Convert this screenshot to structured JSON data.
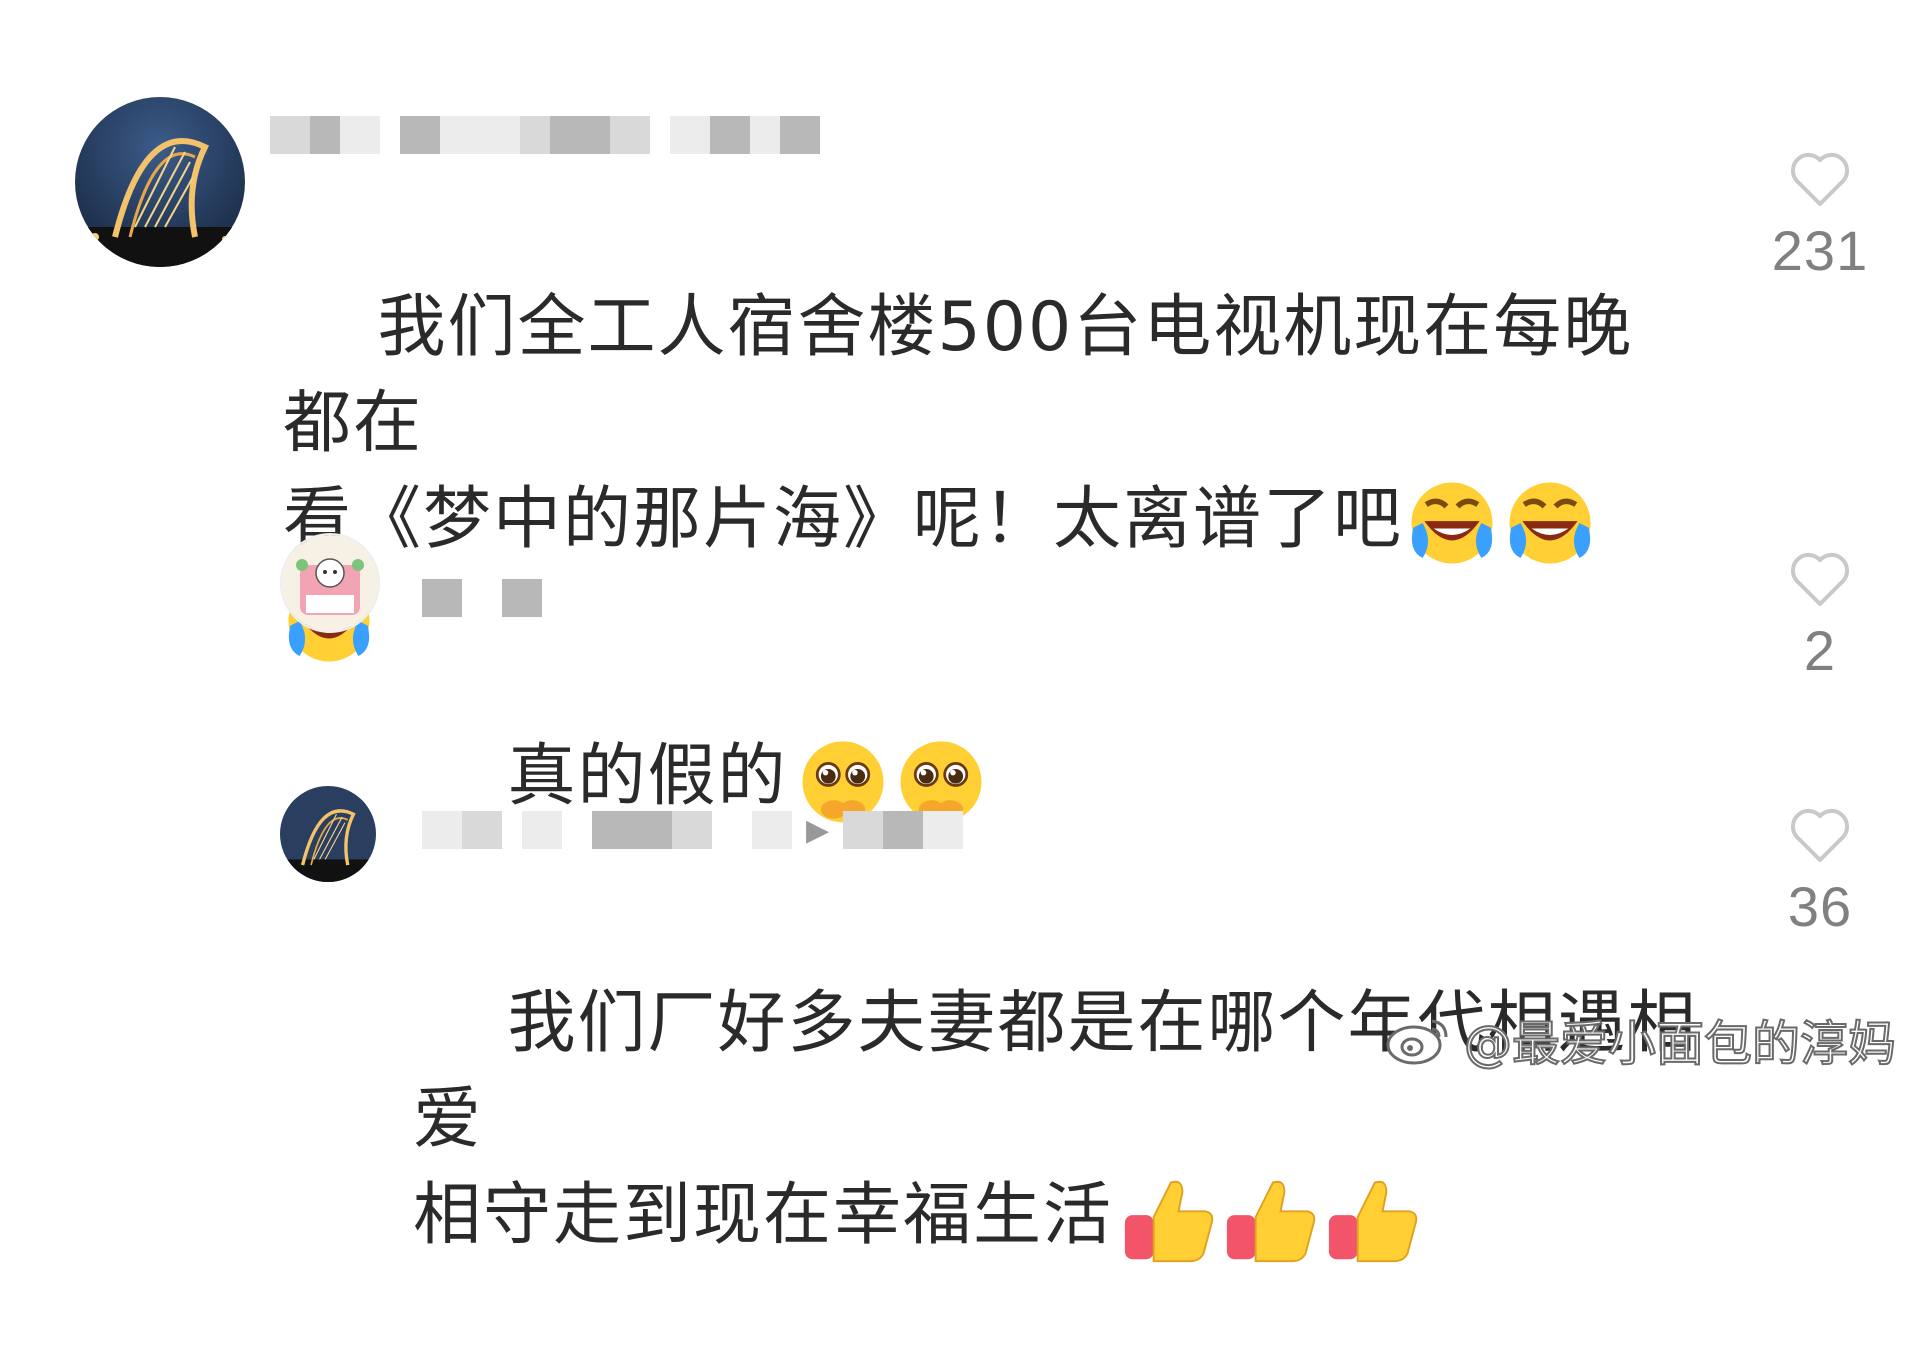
{
  "comments": [
    {
      "text": "我们全工人宿舍楼500台电视机现在每晚都在\n看《梦中的那片海》呢！太离谱了吧",
      "emojis": [
        "laughing-crying-emoji",
        "laughing-crying-emoji",
        "laughing-crying-emoji"
      ],
      "likes": "231"
    },
    {
      "text": "真的假的",
      "emojis": [
        "pleading-emoji",
        "pleading-emoji"
      ],
      "likes": "2"
    },
    {
      "text": "我们厂好多夫妻都是在哪个年代相遇相爱\n相守走到现在幸福生活",
      "emojis": [
        "thumbs-up-emoji",
        "thumbs-up-emoji",
        "thumbs-up-emoji"
      ],
      "likes": "36"
    }
  ],
  "icons": {
    "like": "heart-outline-icon",
    "play": "play-triangle-icon",
    "watermark": "weibo-logo-icon"
  },
  "watermark": {
    "text": "@最爱小面包的淳妈"
  },
  "colors": {
    "text": "#2a2a2a",
    "likeCount": "#808080",
    "heartStroke": "#c9c9c9"
  }
}
